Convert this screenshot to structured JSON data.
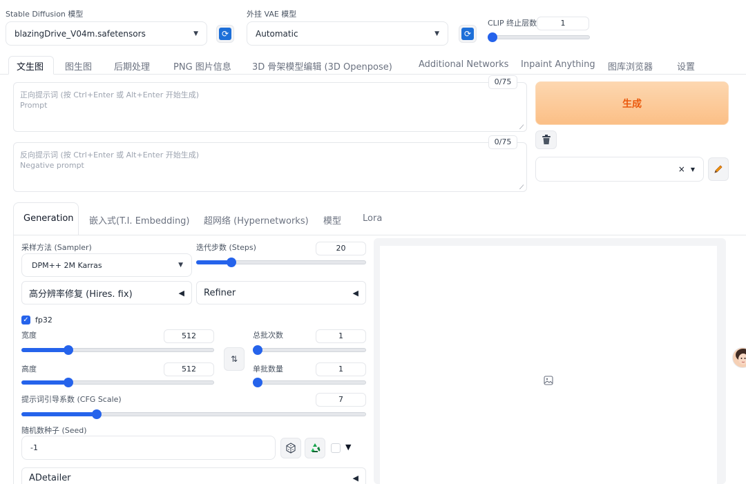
{
  "top": {
    "sd_model_label": "Stable Diffusion 模型",
    "sd_model_value": "blazingDrive_V04m.safetensors",
    "vae_label": "外挂 VAE 模型",
    "vae_value": "Automatic",
    "clip_label": "CLIP 终止层数",
    "clip_value": "1",
    "clip_level": 0.0
  },
  "tabs": [
    "文生图",
    "图生图",
    "后期处理",
    "PNG 图片信息",
    "3D 骨架模型编辑 (3D Openpose)",
    "Additional Networks",
    "Inpaint Anything",
    "图库浏览器",
    "设置"
  ],
  "prompt": {
    "positive_placeholder_line1": "正向提示词 (按 Ctrl+Enter 或 Alt+Enter 开始生成)",
    "positive_placeholder_line2": "Prompt",
    "positive_counter": "0/75",
    "negative_placeholder_line1": "反向提示词 (按 Ctrl+Enter 或 Alt+Enter 开始生成)",
    "negative_placeholder_line2": "Negative prompt",
    "negative_counter": "0/75"
  },
  "actions": {
    "generate_label": "生成",
    "style_clear": "×",
    "trash_icon": "trash-icon",
    "edit_icon": "pencil-icon",
    "accent": "#f97316"
  },
  "subtabs": [
    "Generation",
    "嵌入式(T.I. Embedding)",
    "超网络 (Hypernetworks)",
    "模型",
    "Lora"
  ],
  "gen": {
    "sampler_label": "采样方法 (Sampler)",
    "sampler_value": "DPM++ 2M Karras",
    "steps_label": "迭代步数 (Steps)",
    "steps_value": "20",
    "steps_level": 0.19,
    "hires_label": "高分辨率修复 (Hires. fix)",
    "refiner_label": "Refiner",
    "fp32_label": "fp32",
    "width_label": "宽度",
    "width_value": "512",
    "width_level": 0.23,
    "height_label": "高度",
    "height_value": "512",
    "height_level": 0.23,
    "batch_count_label": "总批次数",
    "batch_count_value": "1",
    "batch_count_level": 0.0,
    "batch_size_label": "单批数量",
    "batch_size_value": "1",
    "batch_size_level": 0.0,
    "swap_icon": "swap-icon",
    "cfg_label": "提示词引导系数 (CFG Scale)",
    "cfg_value": "7",
    "cfg_level": 0.21,
    "seed_label": "随机数种子 (Seed)",
    "seed_value": "-1",
    "adetailer_label": "ADetailer"
  }
}
